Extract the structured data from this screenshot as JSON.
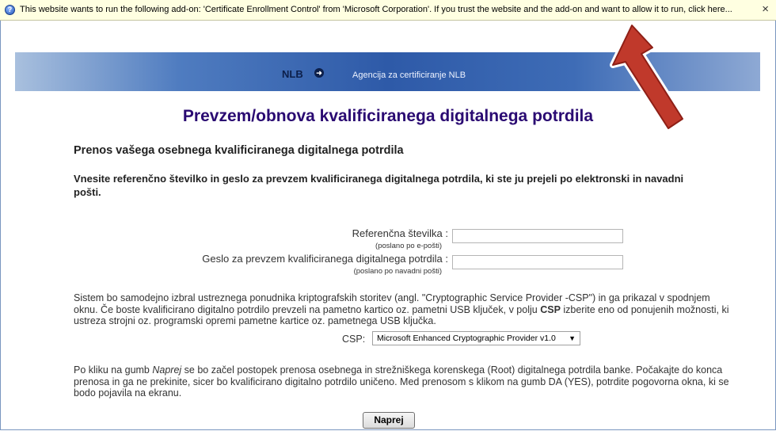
{
  "infobar": {
    "message": "This website wants to run the following add-on: 'Certificate Enrollment Control' from 'Microsoft Corporation'. If you trust the website and the add-on and want to allow it to run, click here...",
    "icon": "help-shield-icon",
    "close_glyph": "×"
  },
  "header": {
    "logo_text": "NLB",
    "agency": "Agencija za certificiranje NLB",
    "colors": {
      "band": "#2e5aa8",
      "title": "#2a0a72",
      "arrow": "#c0392b"
    }
  },
  "page": {
    "title": "Prevzem/obnova kvalificiranega digitalnega potrdila",
    "subtitle": "Prenos vašega osebnega kvalificiranega digitalnega potrdila",
    "instruction": "Vnesite referenčno številko in geslo za prevzem kvalificiranega digitalnega potrdila, ki ste ju prejeli po elektronski in navadni pošti."
  },
  "form": {
    "reference": {
      "label": "Referenčna številka :",
      "note": "(poslano po e-pošti)",
      "value": ""
    },
    "password": {
      "label": "Geslo za prevzem kvalificiranega digitalnega potrdila :",
      "note": "(poslano po navadni pošti)",
      "value": ""
    }
  },
  "csp": {
    "para_part1": "Sistem bo samodejno izbral ustreznega ponudnika kriptografskih storitev  (angl. \"Cryptographic Service Provider -CSP\") in ga prikazal v spodnjem oknu. Če boste kvalificirano digitalno potrdilo prevzeli na pametno kartico oz. pametni USB ključek, v polju ",
    "para_bold": "CSP",
    "para_part2": " izberite eno od ponujenih možnosti, ki ustreza strojni oz. programski opremi pametne kartice oz. pametnega USB ključka.",
    "label": "CSP:",
    "selected": "Microsoft Enhanced Cryptographic Provider v1.0"
  },
  "final": {
    "part1": "Po kliku na gumb ",
    "emph": "Naprej",
    "part2": " se bo začel postopek prenosa osebnega in strežniškega korenskega (Root) digitalnega potrdila banke. Počakajte do konca prenosa in ga ne prekinite, sicer bo kvalificirano digitalno potrdilo uničeno. Med prenosom s klikom na gumb DA (YES), potrdite pogovorna okna, ki se bodo pojavila na ekranu."
  },
  "button": {
    "label": "Naprej"
  }
}
